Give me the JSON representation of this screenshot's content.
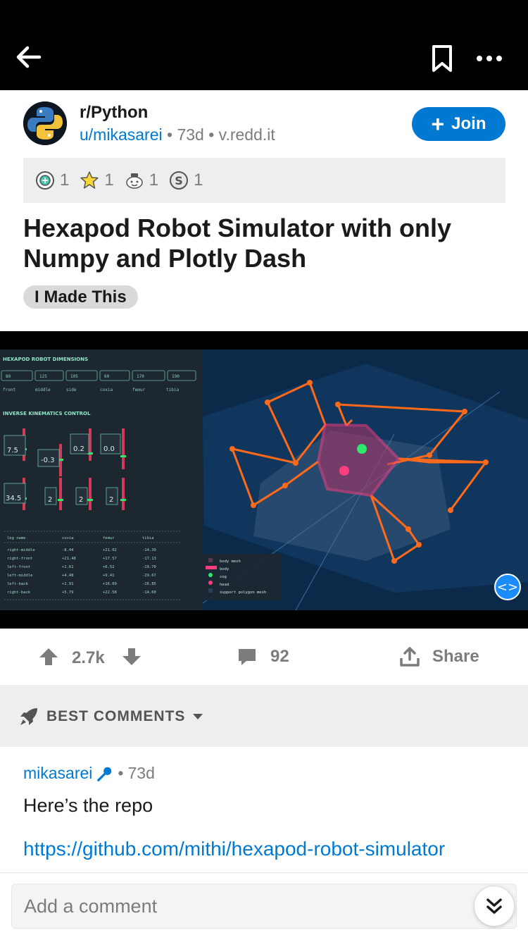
{
  "topbar": {
    "back_icon": "arrow-left-icon",
    "save_icon": "bookmark-icon",
    "more_icon": "more-horizontal-icon"
  },
  "post": {
    "subreddit": "r/Python",
    "author": "u/mikasarei",
    "sep1": "•",
    "age": "73d",
    "sep2": "•",
    "domain": "v.redd.it",
    "join_label": "Join",
    "awards": [
      {
        "icon": "helpful-award-icon",
        "count": "1"
      },
      {
        "icon": "star-award-icon",
        "count": "1"
      },
      {
        "icon": "wholesome-award-icon",
        "count": "1"
      },
      {
        "icon": "silver-award-icon",
        "count": "1"
      }
    ],
    "title": "Hexapod Robot Simulator with only Numpy and Plotly Dash",
    "flair": "I Made This"
  },
  "media": {
    "dims_header": "HEXAPOD ROBOT DIMENSIONS",
    "dims": [
      {
        "value": "80",
        "label": "front"
      },
      {
        "value": "125",
        "label": "middle"
      },
      {
        "value": "105",
        "label": "side"
      },
      {
        "value": "60",
        "label": "coxia"
      },
      {
        "value": "170",
        "label": "femur"
      },
      {
        "value": "190",
        "label": "tibia"
      }
    ],
    "ik_header": "INVERSE KINEMATICS CONTROL",
    "ik_values": [
      "7.5",
      "-0.3",
      "0.2",
      "0.0",
      "34.5",
      "2",
      "2",
      "2"
    ],
    "table_headers": [
      "leg name",
      "coxia",
      "femur",
      "tibia"
    ],
    "table_rows": [
      [
        "right-middle",
        "-8.44",
        "+21.02",
        "-14.39"
      ],
      [
        "right-front",
        "+21.48",
        "+17.57",
        "-17.13"
      ],
      [
        "left-front",
        "+1.61",
        "+6.52",
        "-29.70"
      ],
      [
        "left-middle",
        "+4.48",
        "+9.41",
        "-29.67"
      ],
      [
        "left-back",
        "+1.91",
        "+16.09",
        "-26.85"
      ],
      [
        "right-back",
        "+5.79",
        "+22.58",
        "-14.60"
      ]
    ],
    "legend": [
      "body mesh",
      "body",
      "cog",
      "head",
      "support polygon mesh"
    ],
    "code_icon": "code-brackets-icon"
  },
  "actions": {
    "score": "2.7k",
    "comments": "92",
    "share_label": "Share"
  },
  "sort": {
    "label": "BEST COMMENTS"
  },
  "comment": {
    "user": "mikasarei",
    "sep": "•",
    "age": "73d",
    "text": "Here’s the repo",
    "link": "https://github.com/mithi/hexapod-robot-simulator"
  },
  "composer": {
    "placeholder": "Add a comment"
  },
  "colors": {
    "accent": "#0079d3",
    "body": "#ff3d7f",
    "legs": "#ff6a1a",
    "cog": "#2ee86a",
    "sim_bg": "#0b2a4a"
  }
}
